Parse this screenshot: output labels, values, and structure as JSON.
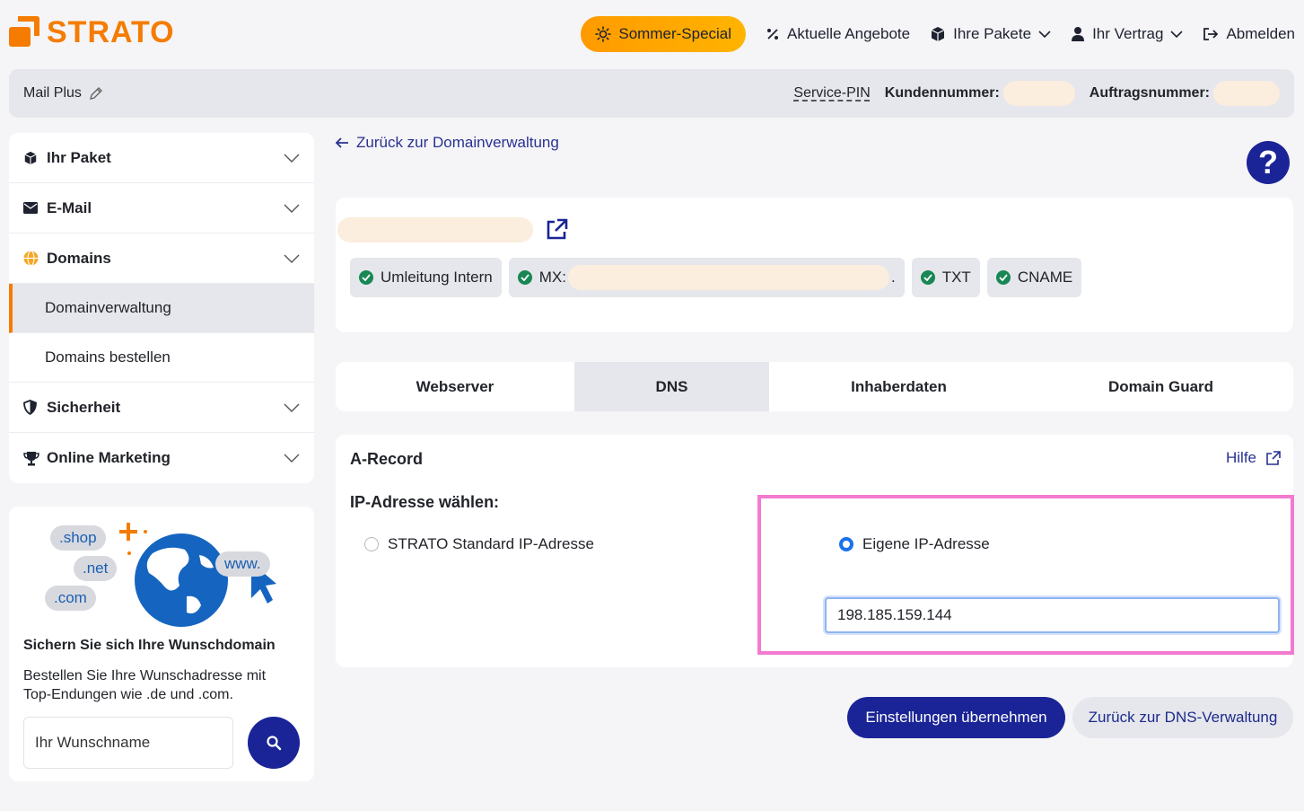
{
  "brand": {
    "name": "STRATO",
    "color": "#f57c00"
  },
  "topnav": {
    "special": "Sommer-Special",
    "offers": "Aktuelle Angebote",
    "packages": "Ihre Pakete",
    "contract": "Ihr Vertrag",
    "logout": "Abmelden"
  },
  "infobar": {
    "package": "Mail Plus",
    "service_pin": "Service-PIN",
    "customer_no_label": "Kundennummer:",
    "order_no_label": "Auftragsnummer:"
  },
  "sidebar": {
    "items": [
      {
        "label": "Ihr Paket",
        "icon": "box-icon"
      },
      {
        "label": "E-Mail",
        "icon": "envelope-icon"
      },
      {
        "label": "Domains",
        "icon": "globe-icon"
      },
      {
        "label": "Sicherheit",
        "icon": "shield-icon"
      },
      {
        "label": "Online Marketing",
        "icon": "trophy-icon"
      }
    ],
    "sub_items": [
      "Domainverwaltung",
      "Domains bestellen"
    ],
    "active_sub": "Domainverwaltung"
  },
  "promo": {
    "bubbles": [
      ".shop",
      ".net",
      ".com",
      "www."
    ],
    "title": "Sichern Sie sich Ihre Wunschdomain",
    "text": "Bestellen Sie Ihre Wunschadresse mit Top-Endungen wie .de und .com.",
    "input_placeholder": "Ihr Wunschname"
  },
  "main": {
    "back_link": "Zurück zur Domainverwaltung",
    "help": "?",
    "chips": {
      "redirect": "Umleitung Intern",
      "mx_label": "MX:",
      "mx_tail": ".",
      "txt": "TXT",
      "cname": "CNAME"
    },
    "tabs": [
      "Webserver",
      "DNS",
      "Inhaberdaten",
      "Domain Guard"
    ],
    "active_tab": "DNS",
    "record": {
      "title": "A-Record",
      "help_link": "Hilfe",
      "ip_label": "IP-Adresse wählen:",
      "option_standard": "STRATO Standard IP-Adresse",
      "option_custom": "Eigene IP-Adresse",
      "selected_option": "Eigene IP-Adresse",
      "ip_value": "198.185.159.144"
    },
    "buttons": {
      "apply": "Einstellungen übernehmen",
      "back_dns": "Zurück zur DNS-Verwaltung"
    }
  }
}
